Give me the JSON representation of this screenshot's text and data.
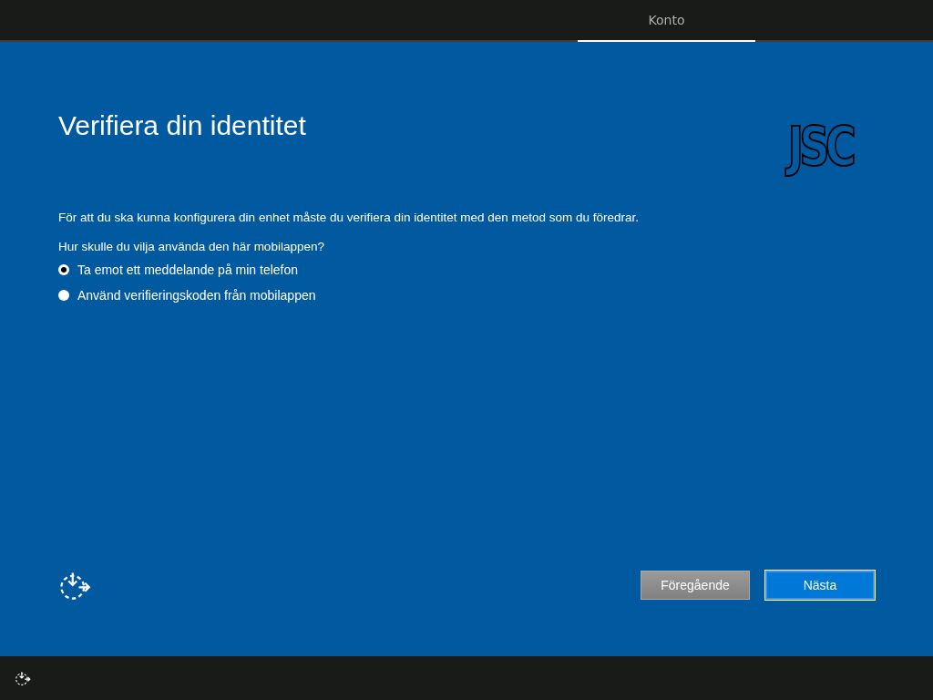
{
  "top_bar": {
    "tabs": [
      {
        "label": "Konto",
        "selected": true
      }
    ]
  },
  "title": "Verifiera din identitet",
  "logo": {
    "text": "JSC"
  },
  "description": "För att du ska kunna konfigurera din enhet måste du verifiera din identitet med den metod som du föredrar.",
  "question": "Hur skulle du vilja använda den här mobilappen?",
  "options": [
    {
      "label": "Ta emot ett meddelande på min telefon",
      "selected": true
    },
    {
      "label": "Använd verifieringskoden från mobilappen",
      "selected": false
    }
  ],
  "buttons": [
    {
      "label": "Föregående",
      "kind": "secondary",
      "disabled": true
    },
    {
      "label": "Nästa",
      "kind": "primary",
      "disabled": false
    }
  ]
}
